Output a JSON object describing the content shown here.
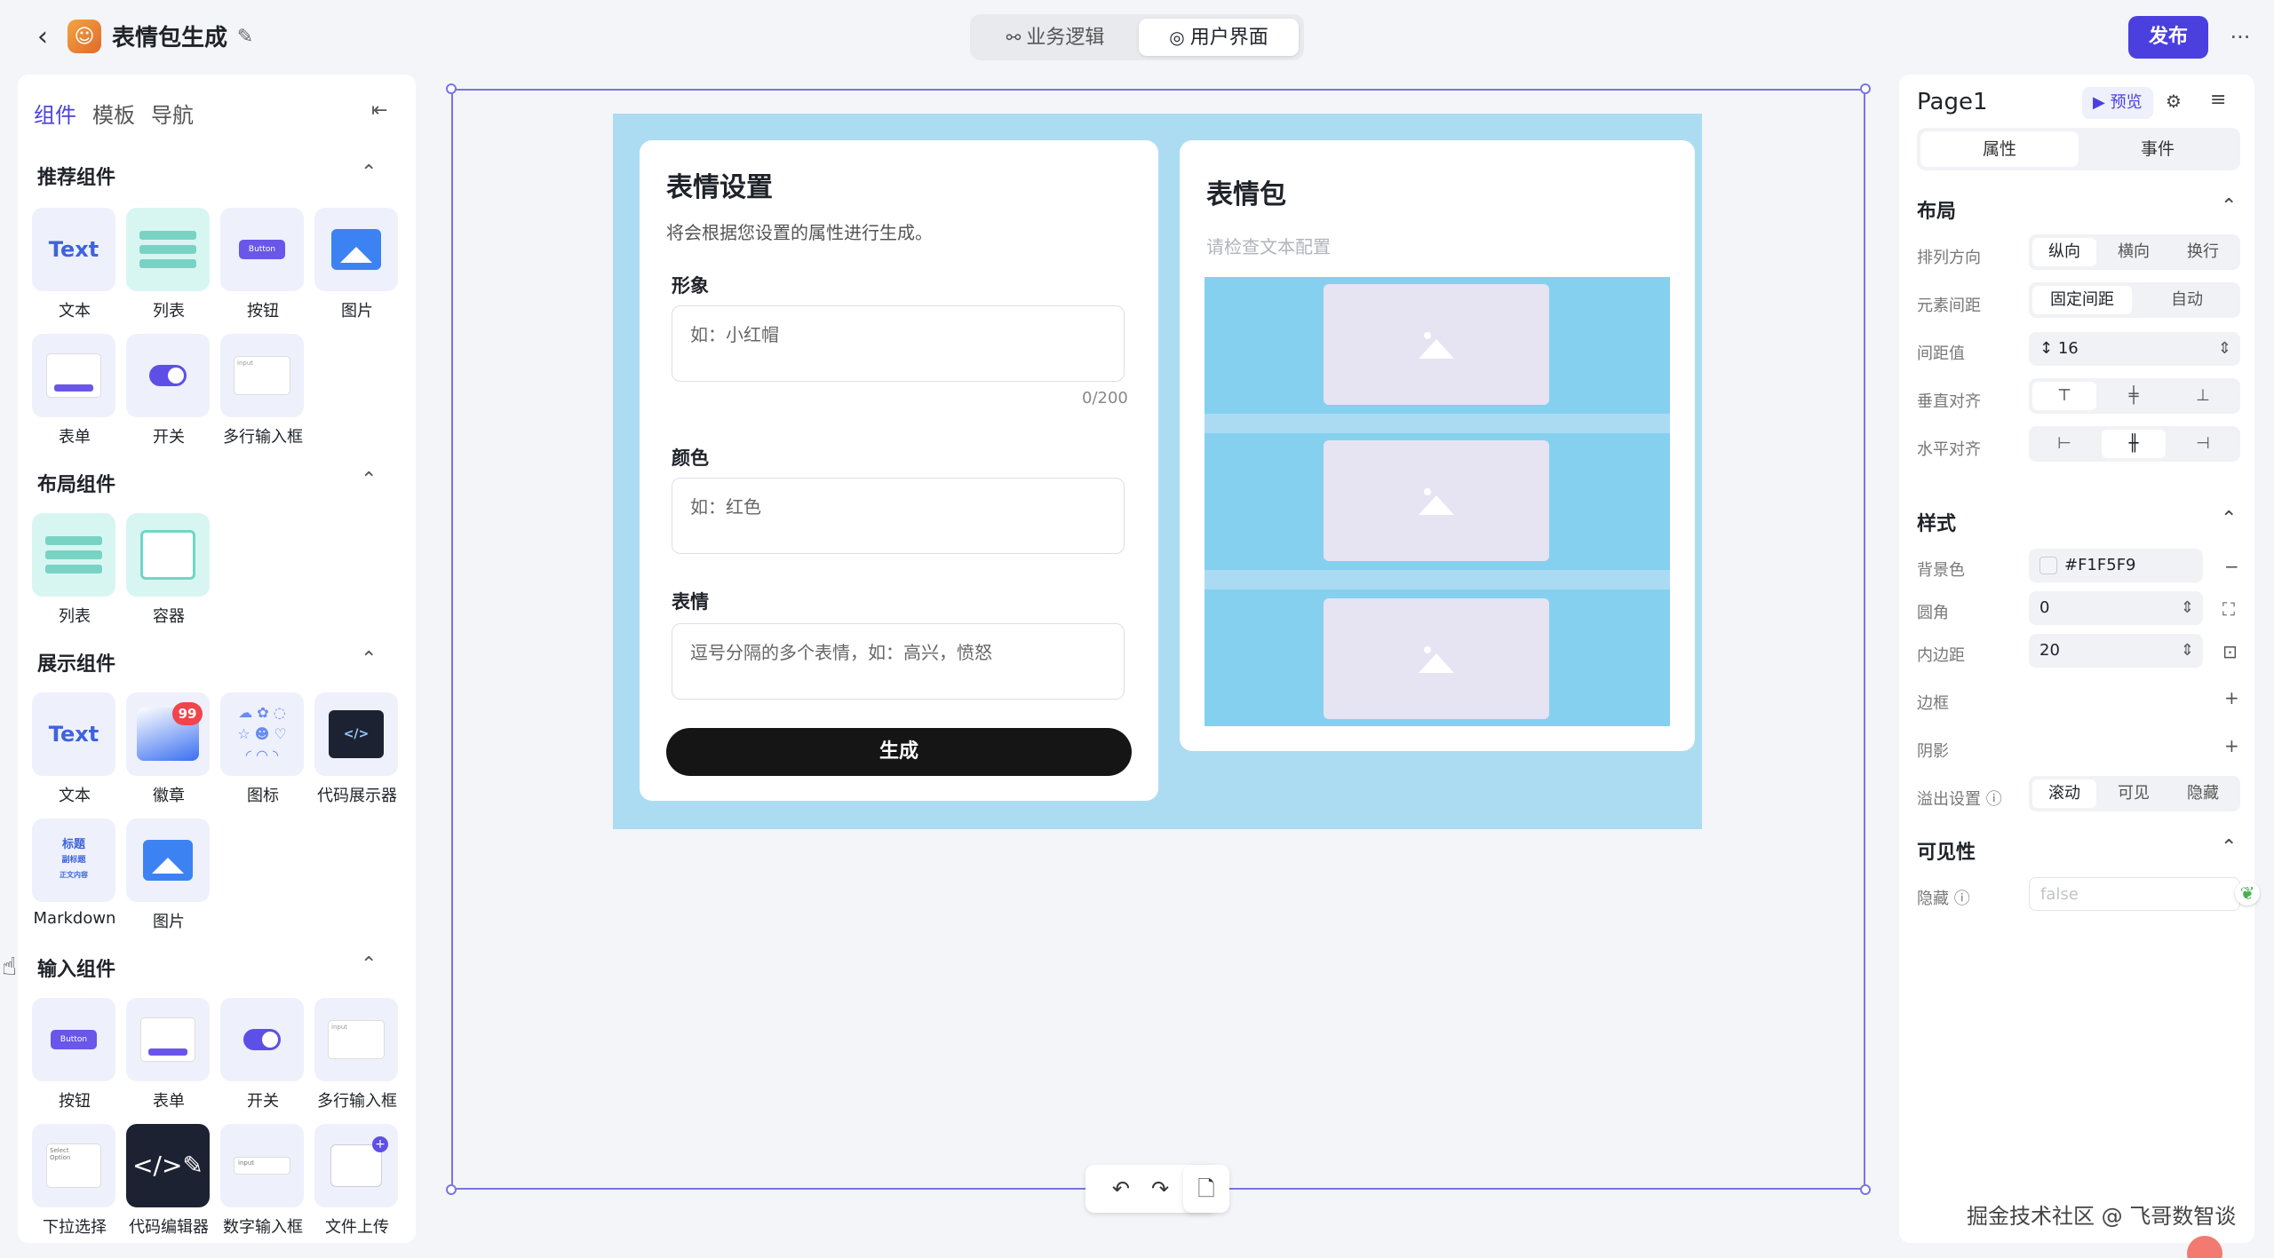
{
  "header": {
    "back_icon": "chevron-left-icon",
    "app_icon": "emoji-app-icon",
    "title": "表情包生成",
    "edit_icon": "edit-icon",
    "segments": [
      {
        "label": "业务逻辑",
        "icon": "flow-icon"
      },
      {
        "label": "用户界面",
        "icon": "palette-icon"
      }
    ],
    "publish_label": "发布",
    "more_icon": "ellipsis-icon"
  },
  "left_panel": {
    "tabs": [
      "组件",
      "模板",
      "导航"
    ],
    "sections": [
      {
        "title": "推荐组件",
        "items": [
          "文本",
          "列表",
          "按钮",
          "图片",
          "表单",
          "开关",
          "多行输入框"
        ]
      },
      {
        "title": "布局组件",
        "items": [
          "列表",
          "容器"
        ]
      },
      {
        "title": "展示组件",
        "items": [
          "文本",
          "徽章",
          "图标",
          "代码展示器",
          "Markdown",
          "图片"
        ]
      },
      {
        "title": "输入组件",
        "items": [
          "按钮",
          "表单",
          "开关",
          "多行输入框",
          "下拉选择",
          "代码编辑器",
          "数字输入框",
          "文件上传"
        ]
      }
    ],
    "tile_texts": {
      "text": "Text",
      "button": "Button",
      "badge": "99",
      "md_title": "标题",
      "md_subtitle": "副标题",
      "md_body": "正文内容",
      "input_hint": "input",
      "select_hint": "Select",
      "option_hint": "Option"
    }
  },
  "canvas": {
    "left_card": {
      "title": "表情设置",
      "subtitle": "将会根据您设置的属性进行生成。",
      "fields": [
        {
          "label": "形象",
          "placeholder": "如：小红帽",
          "counter": "0/200"
        },
        {
          "label": "颜色",
          "placeholder": "如：红色"
        },
        {
          "label": "表情",
          "placeholder": "逗号分隔的多个表情，如：高兴，愤怒"
        }
      ],
      "button_label": "生成"
    },
    "right_card": {
      "title": "表情包",
      "subtitle": "请检查文本配置"
    },
    "toolbar": [
      "undo-icon",
      "redo-icon",
      "file-add-icon"
    ]
  },
  "right_panel": {
    "page_title": "Page1",
    "preview_label": "预览",
    "tabs": [
      "属性",
      "事件"
    ],
    "layout": {
      "title": "布局",
      "direction": {
        "label": "排列方向",
        "options": [
          "纵向",
          "横向",
          "换行"
        ],
        "selected": "纵向"
      },
      "spacing": {
        "label": "元素间距",
        "options": [
          "固定间距",
          "自动"
        ],
        "selected": "固定间距"
      },
      "gap": {
        "label": "间距值",
        "value": "16"
      },
      "valign": {
        "label": "垂直对齐"
      },
      "halign": {
        "label": "水平对齐"
      }
    },
    "style": {
      "title": "样式",
      "bg": {
        "label": "背景色",
        "value": "#F1F5F9"
      },
      "radius": {
        "label": "圆角",
        "value": "0"
      },
      "padding": {
        "label": "内边距",
        "value": "20"
      },
      "border": {
        "label": "边框"
      },
      "shadow": {
        "label": "阴影"
      },
      "overflow": {
        "label": "溢出设置",
        "options": [
          "滚动",
          "可见",
          "隐藏"
        ],
        "selected": "滚动"
      }
    },
    "visibility": {
      "title": "可见性",
      "hidden": {
        "label": "隐藏",
        "placeholder": "false"
      }
    }
  },
  "watermark": "掘金技术社区 @ 飞哥数智谈",
  "colors": {
    "accent": "#4b3fe0",
    "canvas_bg": "#acdcf2",
    "gallery_bg": "#86d0ef"
  }
}
